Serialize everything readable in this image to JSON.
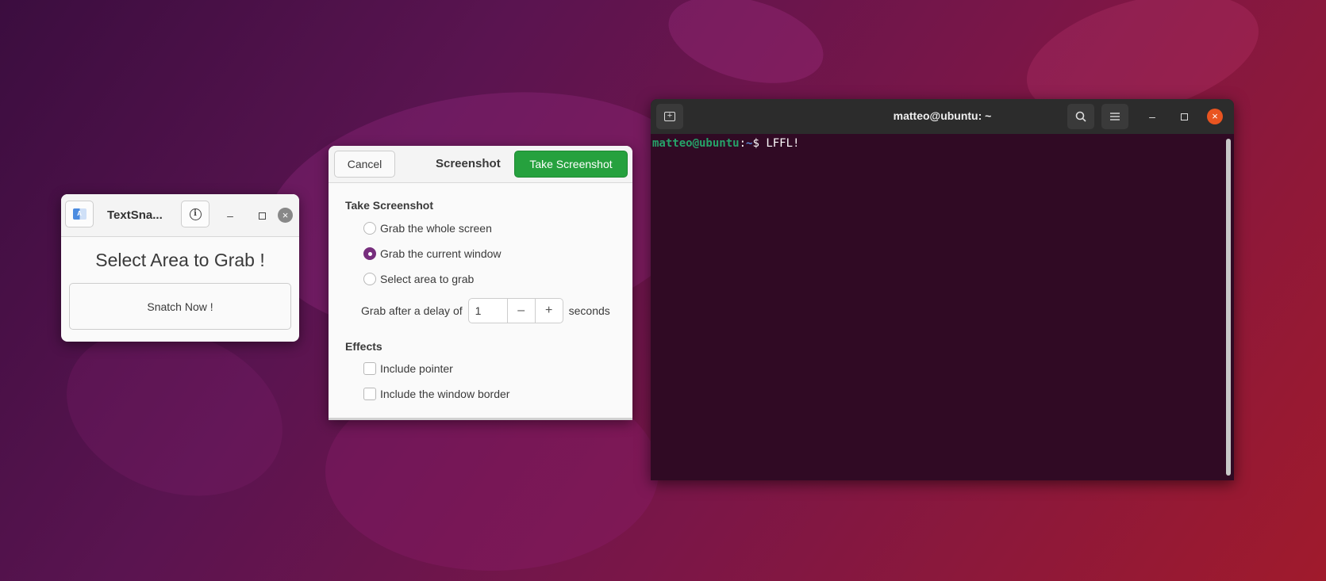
{
  "textsnatcher": {
    "title": "TextSna...",
    "heading": "Select Area to Grab !",
    "snatch_label": "Snatch Now !"
  },
  "screenshot": {
    "cancel_label": "Cancel",
    "title": "Screenshot",
    "take_label": "Take Screenshot",
    "section_take": "Take Screenshot",
    "options": [
      {
        "label": "Grab the whole screen",
        "selected": false
      },
      {
        "label": "Grab the current window",
        "selected": true
      },
      {
        "label": "Select area to grab",
        "selected": false
      }
    ],
    "delay_prefix": "Grab after a delay of",
    "delay_value": "1",
    "delay_suffix": "seconds",
    "section_effects": "Effects",
    "effects": [
      {
        "label": "Include pointer",
        "checked": false
      },
      {
        "label": "Include the window border",
        "checked": false
      }
    ],
    "accent_color": "#26a13e",
    "radio_color": "#772e7d"
  },
  "terminal": {
    "title": "matteo@ubuntu: ~",
    "prompt_user": "matteo@ubuntu",
    "prompt_sep": ":",
    "prompt_path": "~",
    "prompt_symbol": "$ ",
    "command": "LFFL!",
    "close_color": "#e95420"
  }
}
